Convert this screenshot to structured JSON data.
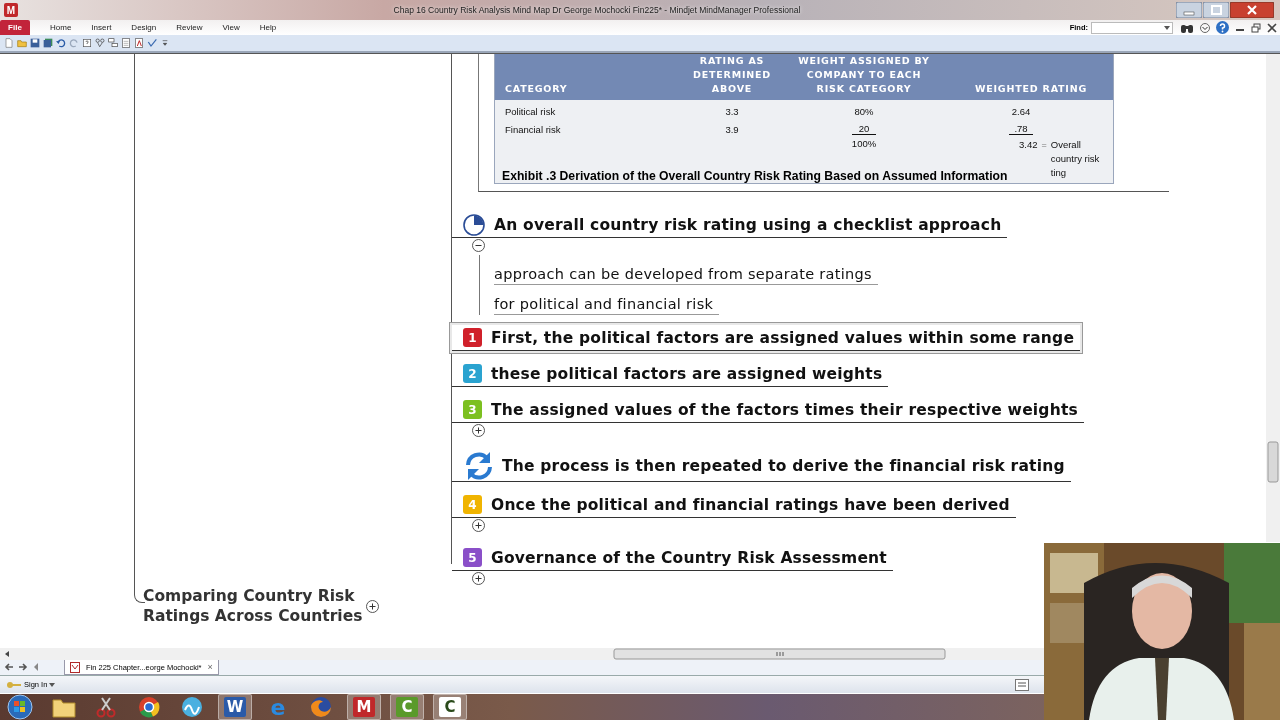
{
  "window": {
    "app_logo": "M",
    "title": "Chap 16 Country Risk Analysis Mind Map Dr George Mochocki Fin225* - Mindjet MindManager Professional"
  },
  "menu": [
    {
      "label": "File",
      "kind": "file"
    },
    {
      "label": "Home",
      "kind": "tab"
    },
    {
      "label": "Insert",
      "kind": "tab"
    },
    {
      "label": "Design",
      "kind": "tab"
    },
    {
      "label": "Review",
      "kind": "tab"
    },
    {
      "label": "View",
      "kind": "tab"
    },
    {
      "label": "Help",
      "kind": "tab"
    }
  ],
  "find": {
    "label": "Find:"
  },
  "exhibit": {
    "columns": [
      "CATEGORY",
      "RATING AS\nDETERMINED\nABOVE",
      "WEIGHT ASSIGNED BY\nCOMPANY TO EACH\nRISK CATEGORY",
      "WEIGHTED RATING"
    ],
    "rows": [
      {
        "cells": [
          "Political risk",
          "3.3",
          "80%",
          "2.64"
        ],
        "sum_line": false
      },
      {
        "cells": [
          "Financial risk",
          "3.9",
          "20",
          ".78"
        ],
        "sum_line": true
      }
    ],
    "total": {
      "weight": "100%",
      "rating": "3.42",
      "sign": "=",
      "note": "Overall\ncountry risk\nting"
    },
    "caption": "Exhibit .3 Derivation of the Overall Country Risk Rating Based on Assumed Information"
  },
  "topics": [
    {
      "kind": "progress",
      "text": "An overall country risk rating using a checklist approach",
      "selected": false,
      "expanded": true,
      "children": [
        {
          "text": "approach can be developed from separate ratings"
        },
        {
          "text": "for political and financial risk"
        }
      ]
    },
    {
      "kind": "priority",
      "number": "1",
      "color": "#d0202a",
      "text": "First, the political factors are assigned values within some range",
      "selected": true
    },
    {
      "kind": "priority",
      "number": "2",
      "color": "#2aa3d0",
      "text": "these political factors are assigned weights",
      "selected": false
    },
    {
      "kind": "priority",
      "number": "3",
      "color": "#7cc020",
      "text": "The assigned values of the factors times their respective weights",
      "selected": false,
      "expanded": false
    },
    {
      "kind": "refresh",
      "text": "The process is then repeated to derive the financial risk rating",
      "selected": false
    },
    {
      "kind": "priority",
      "number": "4",
      "color": "#f0b400",
      "text": "Once the political and financial ratings have been derived",
      "selected": false,
      "expanded": false
    },
    {
      "kind": "priority",
      "number": "5",
      "color": "#8a4fc8",
      "text": "Governance of the Country Risk Assessment",
      "selected": false,
      "expanded": false
    }
  ],
  "left_topic": {
    "text": "Comparing Country Risk\nRatings Across Countries",
    "expanded": false
  },
  "doc_tab": {
    "label": "Fin 225 Chapter...eorge Mochocki*",
    "close": "×"
  },
  "sign_in": {
    "label": "Sign In"
  },
  "taskbar": [
    {
      "kind": "start",
      "running": false
    },
    {
      "kind": "folder",
      "running": false
    },
    {
      "kind": "scissors",
      "running": false
    },
    {
      "kind": "chrome",
      "running": false
    },
    {
      "kind": "wave",
      "running": false
    },
    {
      "kind": "word",
      "glyph": "W",
      "running": true
    },
    {
      "kind": "ie",
      "glyph": "e",
      "running": false
    },
    {
      "kind": "firefox",
      "running": false
    },
    {
      "kind": "mark",
      "glyph": "M",
      "running": true
    },
    {
      "kind": "camtasia",
      "glyph": "C",
      "running": true
    },
    {
      "kind": "camtasia2",
      "glyph": "C",
      "running": true
    }
  ]
}
